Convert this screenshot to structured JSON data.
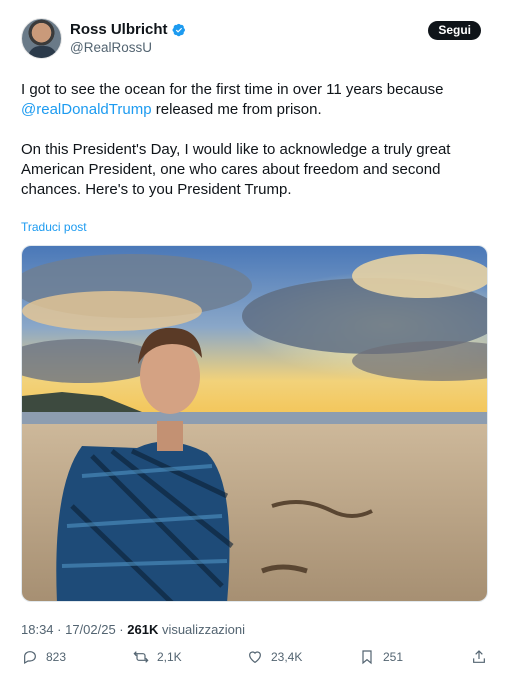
{
  "user": {
    "display_name": "Ross Ulbricht",
    "handle": "@RealRossU"
  },
  "follow_label": "Segui",
  "tweet": {
    "line1_a": "I got to see the ocean for the first time in over 11 years because ",
    "line1_mention": "@realDonaldTrump",
    "line1_b": " released me from prison.",
    "paragraph2": "On this President's Day, I would like to acknowledge a truly great American President, one who cares about freedom and second chances. Here's to you President Trump."
  },
  "translate_label": "Traduci post",
  "meta": {
    "time_date": "18:34 · 17/02/25 · ",
    "views_count": "261K",
    "views_label": " visualizzazioni"
  },
  "actions": {
    "replies": "823",
    "reposts": "2,1K",
    "likes": "23,4K",
    "bookmarks": "251"
  },
  "colors": {
    "accent": "#1d9bf0",
    "text": "#0f1419",
    "secondary": "#536471"
  },
  "icons": [
    "verified-badge-icon",
    "reply-icon",
    "repost-icon",
    "like-icon",
    "bookmark-icon",
    "share-icon"
  ]
}
